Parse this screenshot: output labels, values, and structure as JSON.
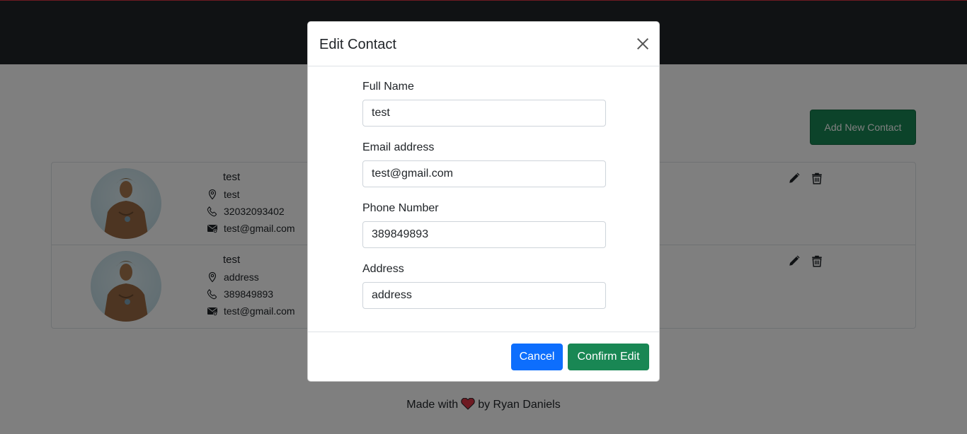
{
  "page": {
    "add_button_label": "Add New Contact",
    "footer": {
      "prefix": "Made with",
      "suffix": "by Ryan Daniels",
      "heart_icon": "heart-icon"
    }
  },
  "contacts": [
    {
      "name": "test",
      "address": "test",
      "phone": "32032093402",
      "email": "test@gmail.com"
    },
    {
      "name": "test",
      "address": "address",
      "phone": "389849893",
      "email": "test@gmail.com"
    }
  ],
  "modal": {
    "title": "Edit Contact",
    "fields": {
      "full_name": {
        "label": "Full Name",
        "value": "test"
      },
      "email": {
        "label": "Email address",
        "value": "test@gmail.com"
      },
      "phone": {
        "label": "Phone Number",
        "value": "389849893"
      },
      "address": {
        "label": "Address",
        "value": "address"
      }
    },
    "cancel_label": "Cancel",
    "confirm_label": "Confirm Edit"
  },
  "colors": {
    "navbar": "#212529",
    "success": "#198754",
    "primary": "#0d6efd",
    "heart": "#dc3545"
  }
}
